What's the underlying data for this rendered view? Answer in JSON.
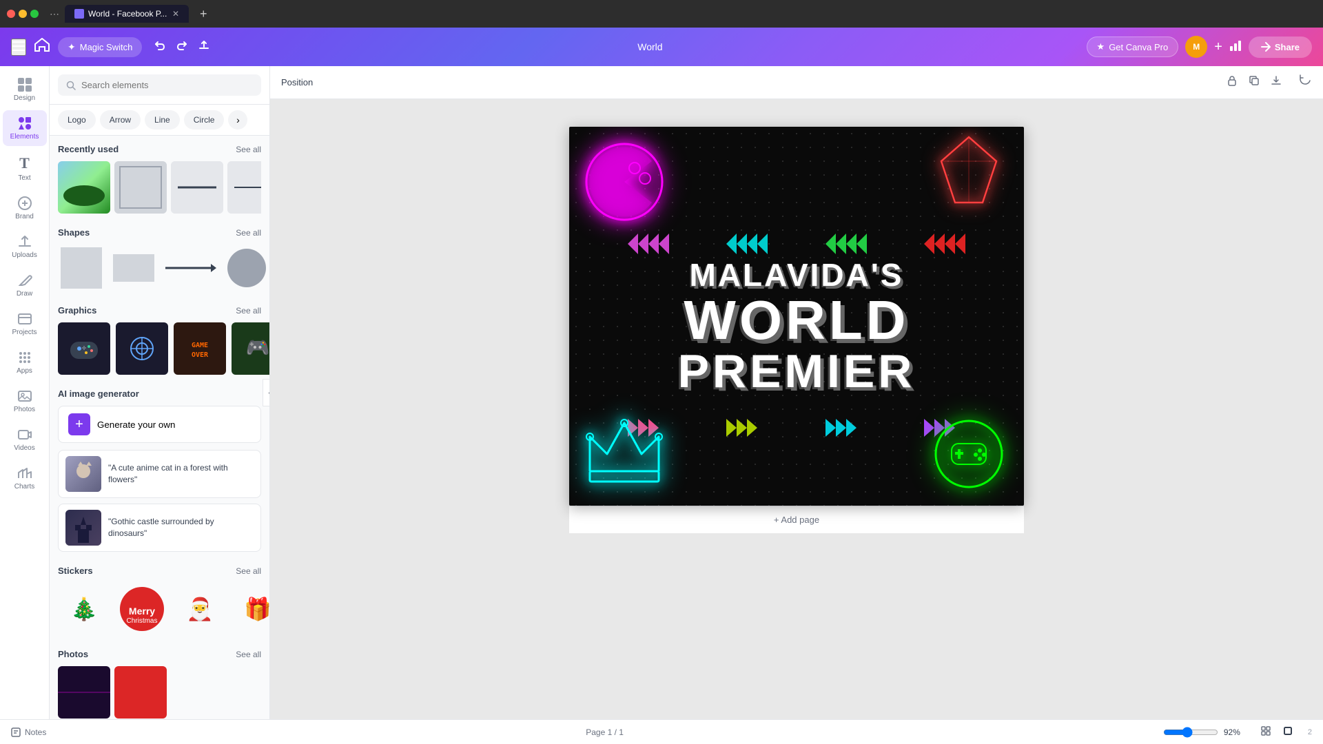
{
  "browser": {
    "tab_title": "World - Facebook P...",
    "new_tab_label": "+",
    "favicon_color": "#7c6af7"
  },
  "topbar": {
    "menu_icon": "☰",
    "home_icon": "⌂",
    "magic_switch_label": "Magic Switch",
    "undo_icon": "↩",
    "redo_icon": "↪",
    "save_icon": "↑",
    "doc_title": "World",
    "get_pro_label": "Get Canva Pro",
    "pro_icon": "★",
    "plus_icon": "+",
    "analytics_icon": "📊",
    "share_icon": "↗",
    "share_label": "Share"
  },
  "sidebar": {
    "items": [
      {
        "id": "design",
        "icon": "⊞",
        "label": "Design"
      },
      {
        "id": "elements",
        "icon": "✦",
        "label": "Elements",
        "active": true
      },
      {
        "id": "text",
        "icon": "T",
        "label": "Text"
      },
      {
        "id": "brand",
        "icon": "◈",
        "label": "Brand"
      },
      {
        "id": "uploads",
        "icon": "⬆",
        "label": "Uploads"
      },
      {
        "id": "draw",
        "icon": "✏",
        "label": "Draw"
      },
      {
        "id": "projects",
        "icon": "⊡",
        "label": "Projects"
      },
      {
        "id": "apps",
        "icon": "⋯",
        "label": "Apps"
      },
      {
        "id": "photos",
        "icon": "🖼",
        "label": "Photos"
      },
      {
        "id": "videos",
        "icon": "▶",
        "label": "Videos"
      },
      {
        "id": "charts",
        "icon": "📈",
        "label": "Charts"
      }
    ]
  },
  "elements_panel": {
    "search_placeholder": "Search elements",
    "filter_tabs": [
      "Logo",
      "Arrow",
      "Line",
      "Circle"
    ],
    "sections": {
      "recently_used": {
        "title": "Recently used",
        "see_all": "See all"
      },
      "shapes": {
        "title": "Shapes",
        "see_all": "See all"
      },
      "graphics": {
        "title": "Graphics",
        "see_all": "See all"
      },
      "ai_generator": {
        "title": "AI image generator",
        "generate_label": "Generate your own",
        "examples": [
          {
            "text": "\"A cute anime cat in a forest with flowers\""
          },
          {
            "text": "\"Gothic castle surrounded by dinosaurs\""
          }
        ]
      },
      "stickers": {
        "title": "Stickers",
        "see_all": "See all"
      },
      "photos": {
        "title": "Photos",
        "see_all": "See all"
      }
    }
  },
  "canvas": {
    "position_label": "Position",
    "design_title_line1": "MALAVIDA'S",
    "design_title_line2": "WORLD",
    "design_title_line3": "PREMIER",
    "add_page_label": "+ Add page"
  },
  "bottom_bar": {
    "notes_label": "Notes",
    "page_info": "Page 1 / 1",
    "zoom_level": "92%"
  }
}
